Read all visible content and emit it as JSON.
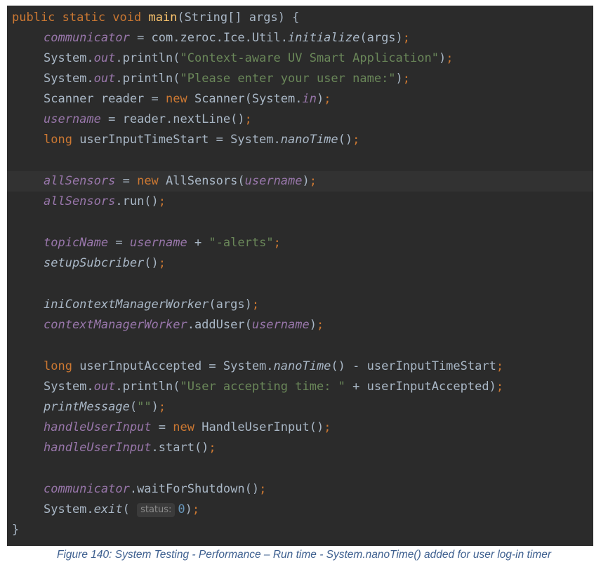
{
  "code": {
    "line_1": {
      "t1": "public static void ",
      "t2": "main",
      "t3": "(String[] args) {"
    },
    "line_2": {
      "t1": "communicator",
      "t2": " = com.zeroc.Ice.Util.",
      "t3": "initialize",
      "t4": "(args)",
      ";": ";"
    },
    "line_3": {
      "t1": "System.",
      "t2": "out",
      "t3": ".println(",
      "t4": "\"Context-aware UV Smart Application\"",
      "t5": ")",
      "t6": ";"
    },
    "line_4": {
      "t1": "System.",
      "t2": "out",
      "t3": ".println(",
      "t4": "\"Please enter your user name:\"",
      "t5": ")",
      "t6": ";"
    },
    "line_5": {
      "t1": "Scanner reader = ",
      "t2": "new ",
      "t3": "Scanner(System.",
      "t4": "in",
      "t5": ")",
      "t6": ";"
    },
    "line_6": {
      "t1": "username",
      "t2": " = reader.nextLine()",
      "t3": ";"
    },
    "line_7": {
      "t1": "long ",
      "t2": "userInputTimeStart = System.",
      "t3": "nanoTime",
      "t4": "()",
      "t5": ";"
    },
    "line_9": {
      "t1": "allSensors",
      "t2": " = ",
      "t3": "new ",
      "t4": "AllSensors(",
      "t5": "username",
      "t6": ")",
      "t7": ";"
    },
    "line_10": {
      "t1": "allSensors",
      "t2": ".run()",
      "t3": ";"
    },
    "line_12": {
      "t1": "topicName",
      "t2": " = ",
      "t3": "username",
      "t4": " + ",
      "t5": "\"-alerts\"",
      "t6": ";"
    },
    "line_13": {
      "t1": "setupSubcriber",
      "t2": "()",
      "t3": ";"
    },
    "line_15": {
      "t1": "iniContextManagerWorker",
      "t2": "(args)",
      "t3": ";"
    },
    "line_16": {
      "t1": "contextManagerWorker",
      "t2": ".addUser(",
      "t3": "username",
      "t4": ")",
      "t5": ";"
    },
    "line_18": {
      "t1": "long ",
      "t2": "userInputAccepted = System.",
      "t3": "nanoTime",
      "t4": "() - userInputTimeStart",
      "t5": ";"
    },
    "line_19": {
      "t1": "System.",
      "t2": "out",
      "t3": ".println(",
      "t4": "\"User accepting time: \"",
      "t5": " + userInputAccepted)",
      "t6": ";"
    },
    "line_20": {
      "t1": "printMessage",
      "t2": "(",
      "t3": "\"\"",
      "t4": ")",
      "t5": ";"
    },
    "line_21": {
      "t1": "handleUserInput",
      "t2": " = ",
      "t3": "new ",
      "t4": "HandleUserInput()",
      "t5": ";"
    },
    "line_22": {
      "t1": "handleUserInput",
      "t2": ".start()",
      "t3": ";"
    },
    "line_24": {
      "t1": "communicator",
      "t2": ".waitForShutdown()",
      "t3": ";"
    },
    "line_25": {
      "t1": "System.",
      "t2": "exit",
      "t3": "( ",
      "hint": "status:",
      "t4": "0",
      "t5": ")",
      "t6": ";"
    },
    "line_26": {
      "t1": "}"
    }
  },
  "caption": "Figure 140: System Testing - Performance – Run time - System.nanoTime() added for user log-in timer"
}
